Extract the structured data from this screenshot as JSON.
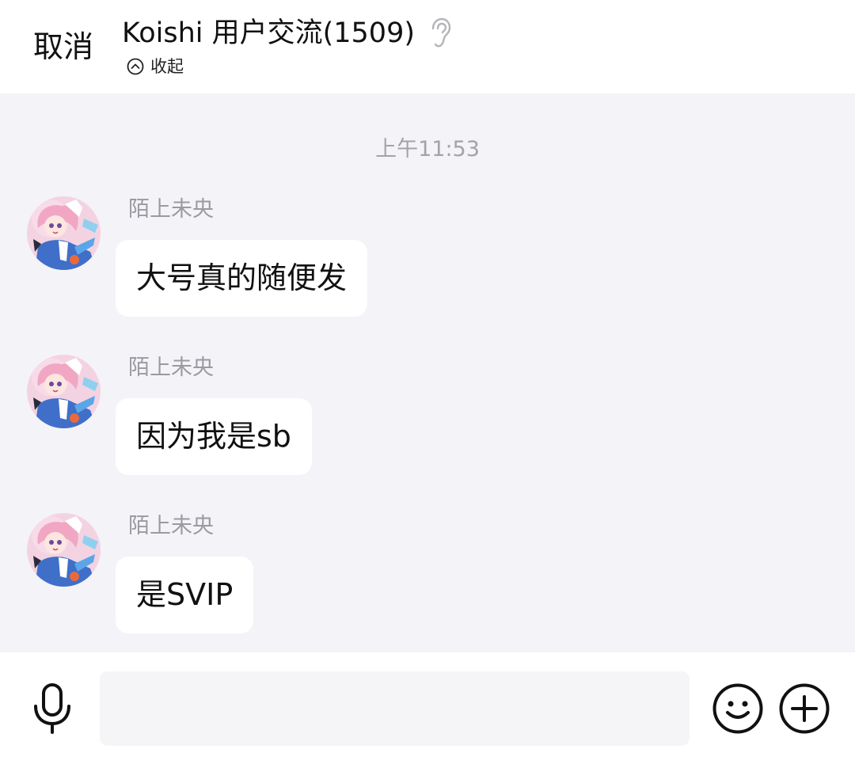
{
  "header": {
    "cancel_label": "取消",
    "title": "Koishi 用户交流(1509)",
    "collapse_label": "收起"
  },
  "chat": {
    "timestamp": "上午11:53",
    "messages": [
      {
        "sender": "陌上未央",
        "text": "大号真的随便发"
      },
      {
        "sender": "陌上未央",
        "text": "因为我是sb"
      },
      {
        "sender": "陌上未央",
        "text": "是SVIP"
      }
    ]
  },
  "input": {
    "value": "",
    "placeholder": ""
  },
  "icons": {
    "header": [
      "ear-icon",
      "collapse-icon"
    ],
    "inputbar": [
      "microphone-icon",
      "emoji-icon",
      "plus-icon"
    ]
  },
  "colors": {
    "chat_background": "#f4f3f7",
    "bubble": "#ffffff",
    "muted_text": "#9a9aa0"
  }
}
